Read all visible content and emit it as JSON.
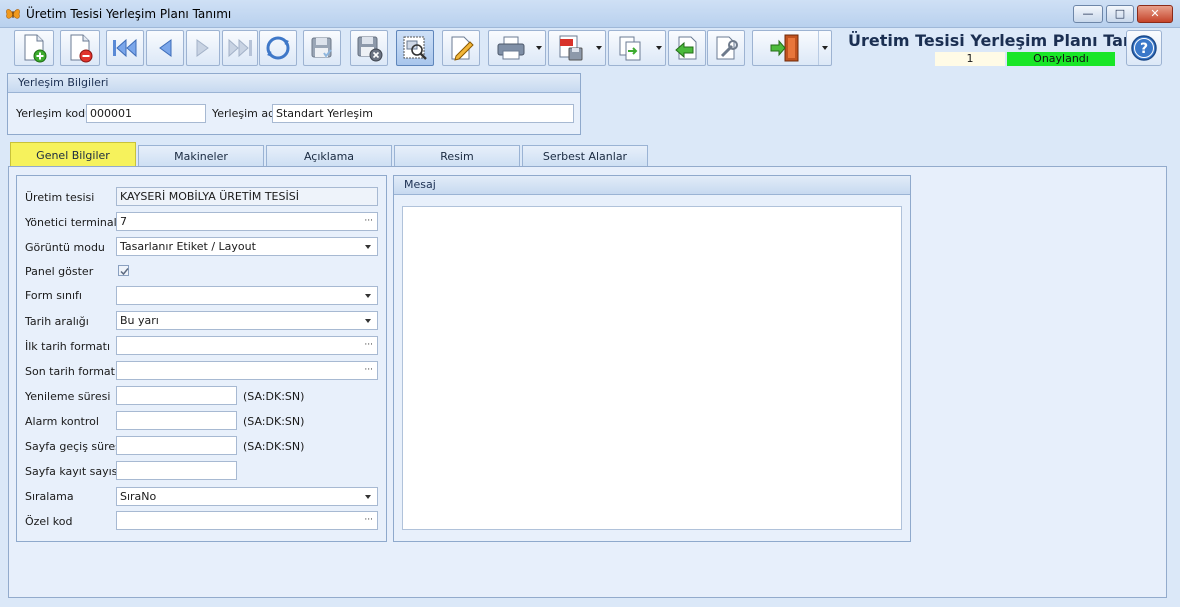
{
  "window": {
    "title": "Üretim Tesisi Yerleşim Planı Tanımı",
    "minimize": "—",
    "maximize": "□",
    "close": "✕"
  },
  "toolbar": {
    "buttons": [
      {
        "name": "new-record",
        "icon": "new-document-icon"
      },
      {
        "name": "delete-record",
        "icon": "delete-document-icon"
      },
      {
        "name": "first-record",
        "icon": "first-icon"
      },
      {
        "name": "previous-record",
        "icon": "previous-icon"
      },
      {
        "name": "next-record",
        "icon": "next-icon"
      },
      {
        "name": "last-record",
        "icon": "last-icon"
      },
      {
        "name": "refresh",
        "icon": "refresh-icon"
      },
      {
        "name": "save",
        "icon": "save-icon"
      },
      {
        "name": "save-close",
        "icon": "save-close-icon"
      },
      {
        "name": "preview",
        "icon": "preview-icon"
      },
      {
        "name": "edit",
        "icon": "edit-icon"
      },
      {
        "name": "print",
        "icon": "printer-icon"
      },
      {
        "name": "export-pdf",
        "icon": "pdf-icon"
      },
      {
        "name": "export",
        "icon": "export-icon"
      },
      {
        "name": "back",
        "icon": "back-icon"
      },
      {
        "name": "settings",
        "icon": "tools-icon"
      },
      {
        "name": "exit",
        "icon": "exit-door-icon"
      }
    ]
  },
  "header": {
    "form_title": "Üretim Tesisi Yerleşim Planı Tanımı",
    "record_number": "1",
    "status": "Onaylandı",
    "status_color": "#19e627"
  },
  "info_group": {
    "title": "Yerleşim Bilgileri",
    "code_label": "Yerleşim kodu",
    "code_value": "000001",
    "name_label": "Yerleşim adı",
    "name_value": "Standart Yerleşim"
  },
  "tabs": [
    {
      "label": "Genel Bilgiler",
      "active": true
    },
    {
      "label": "Makineler",
      "active": false
    },
    {
      "label": "Açıklama",
      "active": false
    },
    {
      "label": "Resim",
      "active": false
    },
    {
      "label": "Serbest Alanlar",
      "active": false
    }
  ],
  "general": {
    "fields": [
      {
        "label": "Üretim tesisi",
        "value": "KAYSERİ MOBİLYA ÜRETİM TESİSİ",
        "kind": "readonly"
      },
      {
        "label": "Yönetici terminal",
        "value": "7",
        "kind": "ellipsis"
      },
      {
        "label": "Görüntü modu",
        "value": "Tasarlanır Etiket / Layout",
        "kind": "dropdown"
      },
      {
        "label": "Panel göster",
        "value": "",
        "kind": "checkbox",
        "checked": true
      },
      {
        "label": "Form sınıfı",
        "value": "",
        "kind": "dropdown"
      },
      {
        "label": "Tarih aralığı",
        "value": "Bu yarı",
        "kind": "dropdown"
      },
      {
        "label": "İlk tarih formatı",
        "value": "",
        "kind": "ellipsis"
      },
      {
        "label": "Son tarih formatı",
        "value": "",
        "kind": "ellipsis"
      },
      {
        "label": "Yenileme süresi",
        "value": "",
        "kind": "time",
        "hint": "(SA:DK:SN)"
      },
      {
        "label": "Alarm kontrol",
        "value": "",
        "kind": "time",
        "hint": "(SA:DK:SN)"
      },
      {
        "label": "Sayfa geçiş süresi",
        "value": "",
        "kind": "time",
        "hint": "(SA:DK:SN)"
      },
      {
        "label": "Sayfa kayıt sayısı",
        "value": "",
        "kind": "short"
      },
      {
        "label": "Sıralama",
        "value": "SıraNo",
        "kind": "dropdown"
      },
      {
        "label": "Özel kod",
        "value": "",
        "kind": "ellipsis"
      }
    ]
  },
  "message": {
    "title": "Mesaj",
    "text": ""
  }
}
